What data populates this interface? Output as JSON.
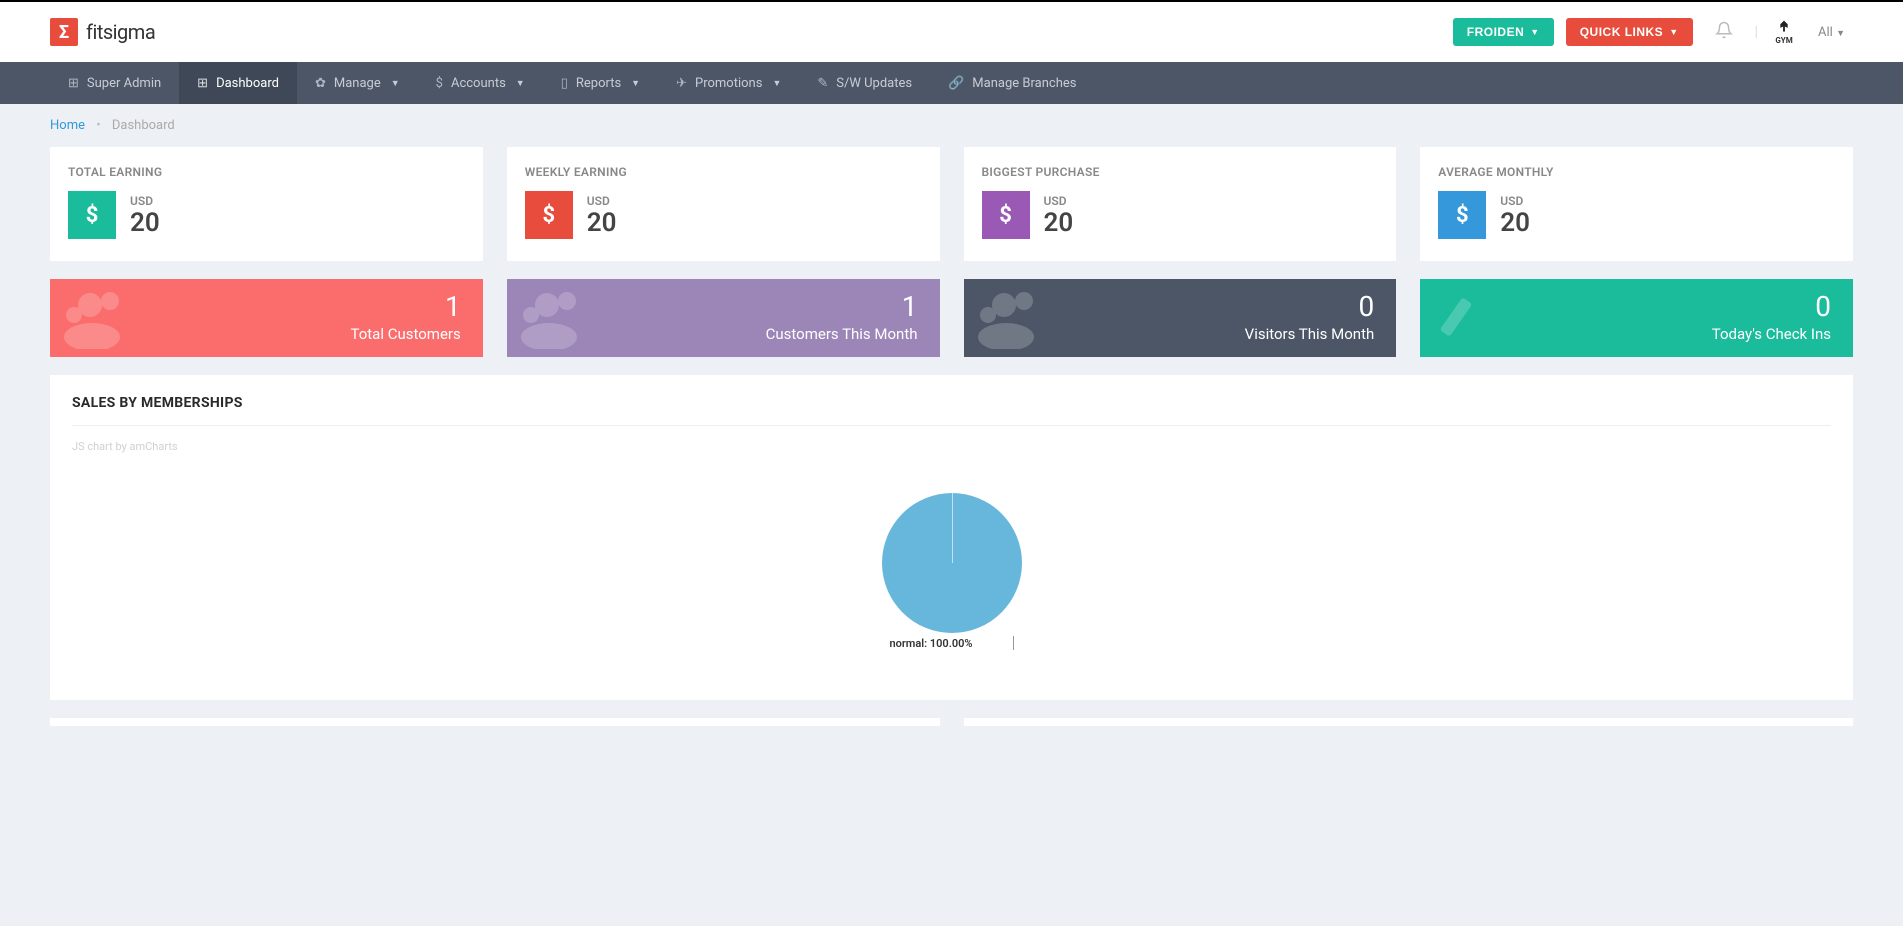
{
  "logo": {
    "mark": "Σ",
    "text": "fitsigma"
  },
  "header": {
    "froiden_btn": "FROIDEN",
    "quicklinks_btn": "QUICK LINKS",
    "gym_label": "GYM",
    "all_label": "All"
  },
  "nav": {
    "super_admin": "Super Admin",
    "dashboard": "Dashboard",
    "manage": "Manage",
    "accounts": "Accounts",
    "reports": "Reports",
    "promotions": "Promotions",
    "sw_updates": "S/W Updates",
    "branches": "Manage Branches"
  },
  "breadcrumb": {
    "home": "Home",
    "current": "Dashboard"
  },
  "stats": {
    "total_earning": {
      "title": "TOTAL EARNING",
      "currency": "USD",
      "value": "20"
    },
    "weekly_earning": {
      "title": "WEEKLY EARNING",
      "currency": "USD",
      "value": "20"
    },
    "biggest_purchase": {
      "title": "BIGGEST PURCHASE",
      "currency": "USD",
      "value": "20"
    },
    "average_monthly": {
      "title": "AVERAGE MONTHLY",
      "currency": "USD",
      "value": "20"
    }
  },
  "tiles": {
    "total_customers": {
      "value": "1",
      "label": "Total Customers"
    },
    "customers_this_month": {
      "value": "1",
      "label": "Customers This Month"
    },
    "visitors_this_month": {
      "value": "0",
      "label": "Visitors This Month"
    },
    "todays_checkins": {
      "value": "0",
      "label": "Today's Check Ins"
    }
  },
  "chart_panel": {
    "title": "SALES BY MEMBERSHIPS",
    "attribution": "JS chart by amCharts",
    "label": "normal: 100.00%"
  },
  "chart_data": {
    "type": "pie",
    "title": "Sales by Memberships",
    "series": [
      {
        "name": "normal",
        "value": 100.0,
        "color": "#67b7dc"
      }
    ]
  }
}
